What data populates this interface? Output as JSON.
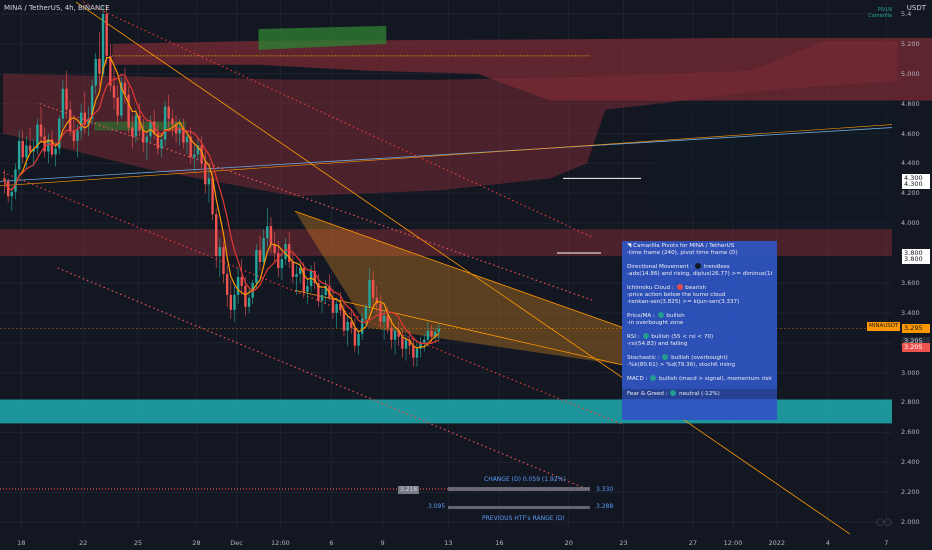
{
  "header": {
    "symbol_line": "MINA / TetherUS, 4h, BINANCE",
    "indicator_legend": [
      "PIVLN",
      "Camarilla"
    ],
    "axis_unit": "USDT"
  },
  "chart_data": {
    "type": "candlestick",
    "ylim": [
      1.94,
      5.48
    ],
    "y_ticks": [
      "5.4",
      "5.200",
      "5.000",
      "4.800",
      "4.600",
      "4.400",
      "4.200",
      "4.000",
      "3.800",
      "3.600",
      "3.400",
      "3.200",
      "3.000",
      "2.800",
      "2.600",
      "2.400",
      "2.200",
      "2.000"
    ],
    "y_tick_values": [
      5.4,
      5.2,
      5.0,
      4.8,
      4.6,
      4.4,
      4.2,
      4.0,
      3.8,
      3.6,
      3.4,
      3.2,
      3.0,
      2.8,
      2.6,
      2.4,
      2.2,
      2.0
    ],
    "x_ticks": [
      "18",
      "22",
      "25",
      "28",
      "Dec",
      "12:00",
      "6",
      "9",
      "13",
      "16",
      "20",
      "23",
      "27",
      "12:00",
      "2022",
      "4",
      "7"
    ],
    "x_tick_slots": [
      5,
      22,
      37,
      53,
      64,
      76,
      90,
      104,
      122,
      136,
      155,
      170,
      189,
      200,
      212,
      226,
      242
    ],
    "candles_ohlc": [
      [
        4.3,
        4.36,
        4.2,
        4.28
      ],
      [
        4.28,
        4.3,
        4.14,
        4.18
      ],
      [
        4.18,
        4.24,
        4.08,
        4.21
      ],
      [
        4.21,
        4.4,
        4.16,
        4.36
      ],
      [
        4.36,
        4.62,
        4.3,
        4.55
      ],
      [
        4.55,
        4.62,
        4.4,
        4.44
      ],
      [
        4.44,
        4.58,
        4.36,
        4.52
      ],
      [
        4.52,
        4.64,
        4.46,
        4.48
      ],
      [
        4.48,
        4.56,
        4.38,
        4.5
      ],
      [
        4.5,
        4.7,
        4.46,
        4.66
      ],
      [
        4.66,
        4.78,
        4.55,
        4.58
      ],
      [
        4.58,
        4.64,
        4.44,
        4.48
      ],
      [
        4.48,
        4.6,
        4.4,
        4.56
      ],
      [
        4.56,
        4.62,
        4.44,
        4.46
      ],
      [
        4.46,
        4.54,
        4.38,
        4.5
      ],
      [
        4.5,
        4.72,
        4.46,
        4.7
      ],
      [
        4.7,
        4.96,
        4.64,
        4.9
      ],
      [
        4.9,
        5.02,
        4.7,
        4.76
      ],
      [
        4.76,
        4.82,
        4.58,
        4.62
      ],
      [
        4.62,
        4.7,
        4.5,
        4.55
      ],
      [
        4.55,
        4.66,
        4.44,
        4.62
      ],
      [
        4.62,
        4.8,
        4.56,
        4.74
      ],
      [
        4.74,
        4.88,
        4.6,
        4.66
      ],
      [
        4.66,
        4.78,
        4.58,
        4.7
      ],
      [
        4.7,
        4.96,
        4.66,
        4.92
      ],
      [
        4.92,
        5.14,
        4.86,
        5.1
      ],
      [
        5.1,
        5.28,
        4.92,
        5.0
      ],
      [
        5.0,
        5.46,
        4.98,
        5.4
      ],
      [
        5.4,
        5.46,
        5.06,
        5.12
      ],
      [
        5.12,
        5.2,
        4.88,
        4.92
      ],
      [
        4.92,
        5.04,
        4.76,
        4.84
      ],
      [
        4.84,
        4.92,
        4.66,
        4.72
      ],
      [
        4.72,
        4.98,
        4.7,
        4.94
      ],
      [
        4.94,
        5.04,
        4.8,
        4.86
      ],
      [
        4.86,
        4.92,
        4.6,
        4.64
      ],
      [
        4.64,
        4.72,
        4.5,
        4.58
      ],
      [
        4.58,
        4.76,
        4.54,
        4.72
      ],
      [
        4.72,
        4.8,
        4.58,
        4.62
      ],
      [
        4.62,
        4.7,
        4.48,
        4.54
      ],
      [
        4.54,
        4.62,
        4.42,
        4.58
      ],
      [
        4.58,
        4.72,
        4.54,
        4.68
      ],
      [
        4.68,
        4.76,
        4.56,
        4.6
      ],
      [
        4.6,
        4.66,
        4.46,
        4.5
      ],
      [
        4.5,
        4.6,
        4.44,
        4.56
      ],
      [
        4.56,
        4.82,
        4.52,
        4.78
      ],
      [
        4.78,
        4.86,
        4.64,
        4.7
      ],
      [
        4.7,
        4.76,
        4.58,
        4.66
      ],
      [
        4.66,
        4.72,
        4.54,
        4.6
      ],
      [
        4.6,
        4.7,
        4.52,
        4.64
      ],
      [
        4.64,
        4.7,
        4.5,
        4.54
      ],
      [
        4.54,
        4.62,
        4.46,
        4.58
      ],
      [
        4.58,
        4.64,
        4.4,
        4.44
      ],
      [
        4.44,
        4.52,
        4.34,
        4.46
      ],
      [
        4.46,
        4.58,
        4.42,
        4.52
      ],
      [
        4.52,
        4.58,
        4.36,
        4.4
      ],
      [
        4.4,
        4.48,
        4.2,
        4.26
      ],
      [
        4.26,
        4.36,
        4.14,
        4.3
      ],
      [
        4.3,
        4.34,
        4.02,
        4.06
      ],
      [
        4.06,
        4.1,
        3.7,
        3.78
      ],
      [
        3.78,
        3.9,
        3.64,
        3.84
      ],
      [
        3.84,
        3.88,
        3.6,
        3.66
      ],
      [
        3.66,
        3.72,
        3.44,
        3.52
      ],
      [
        3.52,
        3.62,
        3.36,
        3.42
      ],
      [
        3.42,
        3.58,
        3.34,
        3.52
      ],
      [
        3.52,
        3.7,
        3.46,
        3.64
      ],
      [
        3.64,
        3.76,
        3.52,
        3.58
      ],
      [
        3.58,
        3.64,
        3.38,
        3.44
      ],
      [
        3.44,
        3.56,
        3.4,
        3.5
      ],
      [
        3.5,
        3.62,
        3.46,
        3.6
      ],
      [
        3.6,
        3.86,
        3.56,
        3.82
      ],
      [
        3.82,
        3.92,
        3.68,
        3.74
      ],
      [
        3.74,
        3.96,
        3.7,
        3.9
      ],
      [
        3.9,
        4.1,
        3.84,
        3.98
      ],
      [
        3.98,
        4.04,
        3.8,
        3.86
      ],
      [
        3.86,
        3.94,
        3.74,
        3.8
      ],
      [
        3.8,
        3.88,
        3.64,
        3.7
      ],
      [
        3.7,
        3.8,
        3.62,
        3.76
      ],
      [
        3.76,
        3.9,
        3.72,
        3.86
      ],
      [
        3.86,
        3.94,
        3.7,
        3.74
      ],
      [
        3.74,
        3.8,
        3.6,
        3.64
      ],
      [
        3.64,
        3.72,
        3.52,
        3.66
      ],
      [
        3.66,
        3.76,
        3.6,
        3.7
      ],
      [
        3.7,
        3.74,
        3.5,
        3.54
      ],
      [
        3.54,
        3.62,
        3.46,
        3.58
      ],
      [
        3.58,
        3.72,
        3.54,
        3.68
      ],
      [
        3.68,
        3.74,
        3.56,
        3.6
      ],
      [
        3.6,
        3.66,
        3.44,
        3.48
      ],
      [
        3.48,
        3.56,
        3.4,
        3.52
      ],
      [
        3.52,
        3.62,
        3.46,
        3.58
      ],
      [
        3.58,
        3.66,
        3.48,
        3.5
      ],
      [
        3.5,
        3.56,
        3.36,
        3.4
      ],
      [
        3.4,
        3.5,
        3.3,
        3.46
      ],
      [
        3.46,
        3.54,
        3.38,
        3.42
      ],
      [
        3.42,
        3.48,
        3.24,
        3.28
      ],
      [
        3.28,
        3.38,
        3.18,
        3.34
      ],
      [
        3.34,
        3.42,
        3.26,
        3.3
      ],
      [
        3.3,
        3.36,
        3.14,
        3.18
      ],
      [
        3.18,
        3.28,
        3.12,
        3.26
      ],
      [
        3.26,
        3.4,
        3.22,
        3.36
      ],
      [
        3.36,
        3.46,
        3.3,
        3.44
      ],
      [
        3.44,
        3.7,
        3.4,
        3.62
      ],
      [
        3.62,
        3.68,
        3.44,
        3.5
      ],
      [
        3.5,
        3.58,
        3.4,
        3.46
      ],
      [
        3.46,
        3.52,
        3.3,
        3.34
      ],
      [
        3.34,
        3.42,
        3.22,
        3.38
      ],
      [
        3.38,
        3.44,
        3.26,
        3.3
      ],
      [
        3.3,
        3.36,
        3.16,
        3.22
      ],
      [
        3.22,
        3.3,
        3.12,
        3.28
      ],
      [
        3.28,
        3.34,
        3.18,
        3.24
      ],
      [
        3.24,
        3.3,
        3.1,
        3.16
      ],
      [
        3.16,
        3.26,
        3.08,
        3.22
      ],
      [
        3.22,
        3.28,
        3.12,
        3.18
      ],
      [
        3.18,
        3.24,
        3.04,
        3.1
      ],
      [
        3.1,
        3.2,
        3.04,
        3.16
      ],
      [
        3.16,
        3.24,
        3.1,
        3.2
      ],
      [
        3.2,
        3.26,
        3.14,
        3.22
      ],
      [
        3.22,
        3.34,
        3.18,
        3.28
      ],
      [
        3.28,
        3.32,
        3.2,
        3.24
      ],
      [
        3.24,
        3.3,
        3.2,
        3.27
      ],
      [
        3.27,
        3.33,
        3.21,
        3.295
      ]
    ],
    "last_price": "3.295",
    "ichimoku_cloud": "bearish",
    "horizontal_zones": [
      {
        "name": "resistance",
        "from": 3.78,
        "to": 3.96,
        "color": "#7a2b34"
      },
      {
        "name": "support",
        "from": 2.66,
        "to": 2.82,
        "color": "#1fa3a8"
      }
    ],
    "price_tags": [
      {
        "label": "4.300",
        "value": 4.3,
        "style": "white"
      },
      {
        "label": "4.300",
        "value": 4.26,
        "style": "white"
      },
      {
        "label": "3.800",
        "value": 3.8,
        "style": "white"
      },
      {
        "label": "3.800",
        "value": 3.76,
        "style": "white"
      },
      {
        "label": "3.295",
        "value": 3.295,
        "style": "orange"
      },
      {
        "label": "3.205",
        "value": 3.205,
        "style": "grey"
      },
      {
        "label": "3.205",
        "value": 3.165,
        "style": "red"
      }
    ],
    "symbol_tag": "MINAUSDT",
    "mini_values": [
      "3.218",
      "3.330",
      "3.095",
      "3.288"
    ],
    "bottom_labels": [
      "CHANGE (D) 0.059 (1.92%)",
      "PREVIOUS HTF's RANGE (D)"
    ]
  },
  "info_panel": {
    "lines": [
      {
        "text": "◥ Camarilla Pivots for MINA / TetherUS"
      },
      {
        "text": "-time frame (240), pivot time frame (D)"
      },
      {
        "gap": true
      },
      {
        "text": "Directional Movement : ",
        "dot": "#131722",
        "after": " trendless"
      },
      {
        "text": "-adx(14.86) and rising, diplus(26.77) >= diminus(16.84)"
      },
      {
        "gap": true
      },
      {
        "text": "Ichimoku Cloud : ",
        "dot": "#ef5350",
        "after": " bearish"
      },
      {
        "text": "-price action below the kumo cloud"
      },
      {
        "text": "-tenkan-sen(3.825) >= kijun-sen(3.337)"
      },
      {
        "gap": true
      },
      {
        "text": "Price/MA : ",
        "dot": "#26a69a",
        "after": " bullish"
      },
      {
        "text": "-in overbought zone"
      },
      {
        "gap": true
      },
      {
        "text": "RSI : ",
        "dot": "#26a69a",
        "after": " bullish (55 < rsi < 70)"
      },
      {
        "text": "-rsi(54.83) and falling"
      },
      {
        "gap": true
      },
      {
        "text": "Stochastic : ",
        "dot": "#26a69a",
        "after": " bullish (overbought)"
      },
      {
        "text": "-%k(80.61) > %d(79.36), stochK rising"
      },
      {
        "gap": true
      },
      {
        "text": "MACD : ",
        "dot": "#26a69a",
        "after": " bullish (macd > signal), momentum rising"
      },
      {
        "gap": true
      },
      {
        "text": "Fear & Greed : ",
        "dot": "#26a69a",
        "after": " neutral (-12%)",
        "shade": true
      }
    ]
  },
  "colors": {
    "background": "#131722",
    "bull": "#26a69a",
    "bear": "#ef5350",
    "cloud_bear": "#7a2b34",
    "cloud_bull": "#2e7d32",
    "wedge": "#e08a1e",
    "trend": "#ff9800",
    "panel": "#2f55c3"
  }
}
